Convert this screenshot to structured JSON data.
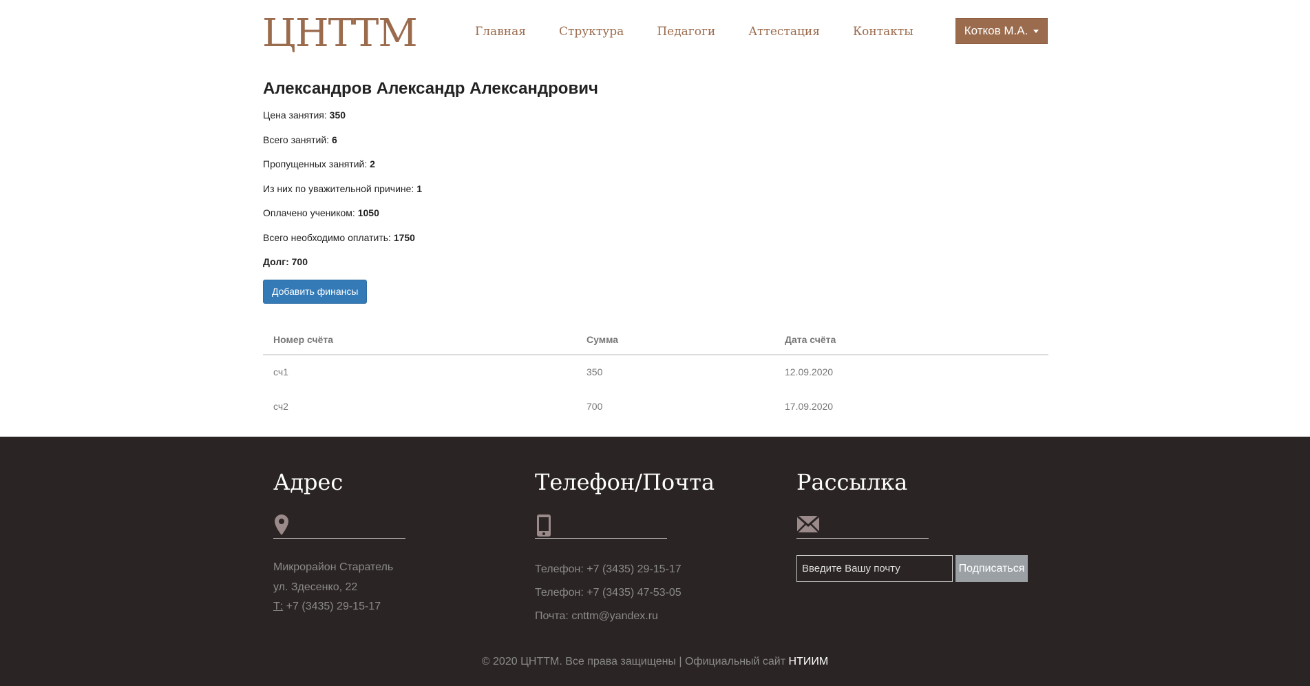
{
  "header": {
    "logo": "ЦНТТМ",
    "nav": [
      "Главная",
      "Структура",
      "Педагоги",
      "Аттестация",
      "Контакты"
    ],
    "user": "Котков М.А."
  },
  "student": {
    "name": "Александров Александр Александрович",
    "lesson_price_label": "Цена занятия:",
    "lesson_price": "350",
    "total_lessons_label": "Всего занятий:",
    "total_lessons": "6",
    "missed_label": "Пропущенных занятий:",
    "missed": "2",
    "excused_label": "Из них по уважительной причине:",
    "excused": "1",
    "paid_label": "Оплачено учеником:",
    "paid": "1050",
    "total_due_label": "Всего необходимо оплатить:",
    "total_due": "1750",
    "debt_label": "Долг:",
    "debt": "700",
    "add_button": "Добавить финансы"
  },
  "table": {
    "headers": [
      "Номер счёта",
      "Сумма",
      "Дата счёта"
    ],
    "rows": [
      [
        "сч1",
        "350",
        "12.09.2020"
      ],
      [
        "сч2",
        "700",
        "17.09.2020"
      ]
    ]
  },
  "footer": {
    "address_title": "Адрес",
    "address_lines": [
      "Микрорайон Старатель",
      "ул. Здесенко, 22"
    ],
    "address_phone_label": "Т:",
    "address_phone": "+7 (3435) 29-15-17",
    "contacts_title": "Телефон/Почта",
    "contacts_lines": [
      "Телефон: +7 (3435) 29-15-17",
      "Телефон: +7 (3435) 47-53-05",
      "Почта: cnttm@yandex.ru"
    ],
    "newsletter_title": "Рассылка",
    "email_placeholder": "Введите Вашу почту",
    "subscribe_button": "Подписаться",
    "copyright": "© 2020 ЦНТТМ. Все права защищены | Официальный сайт",
    "copyright_link": "НТИИМ"
  },
  "icons": {
    "address": "map-marker-icon",
    "phone": "mobile-phone-icon",
    "newsletter": "envelope-icon"
  },
  "colors": {
    "brand": "#9b6b4d",
    "primary_button": "#337ab7",
    "footer_bg": "#2b2424"
  }
}
